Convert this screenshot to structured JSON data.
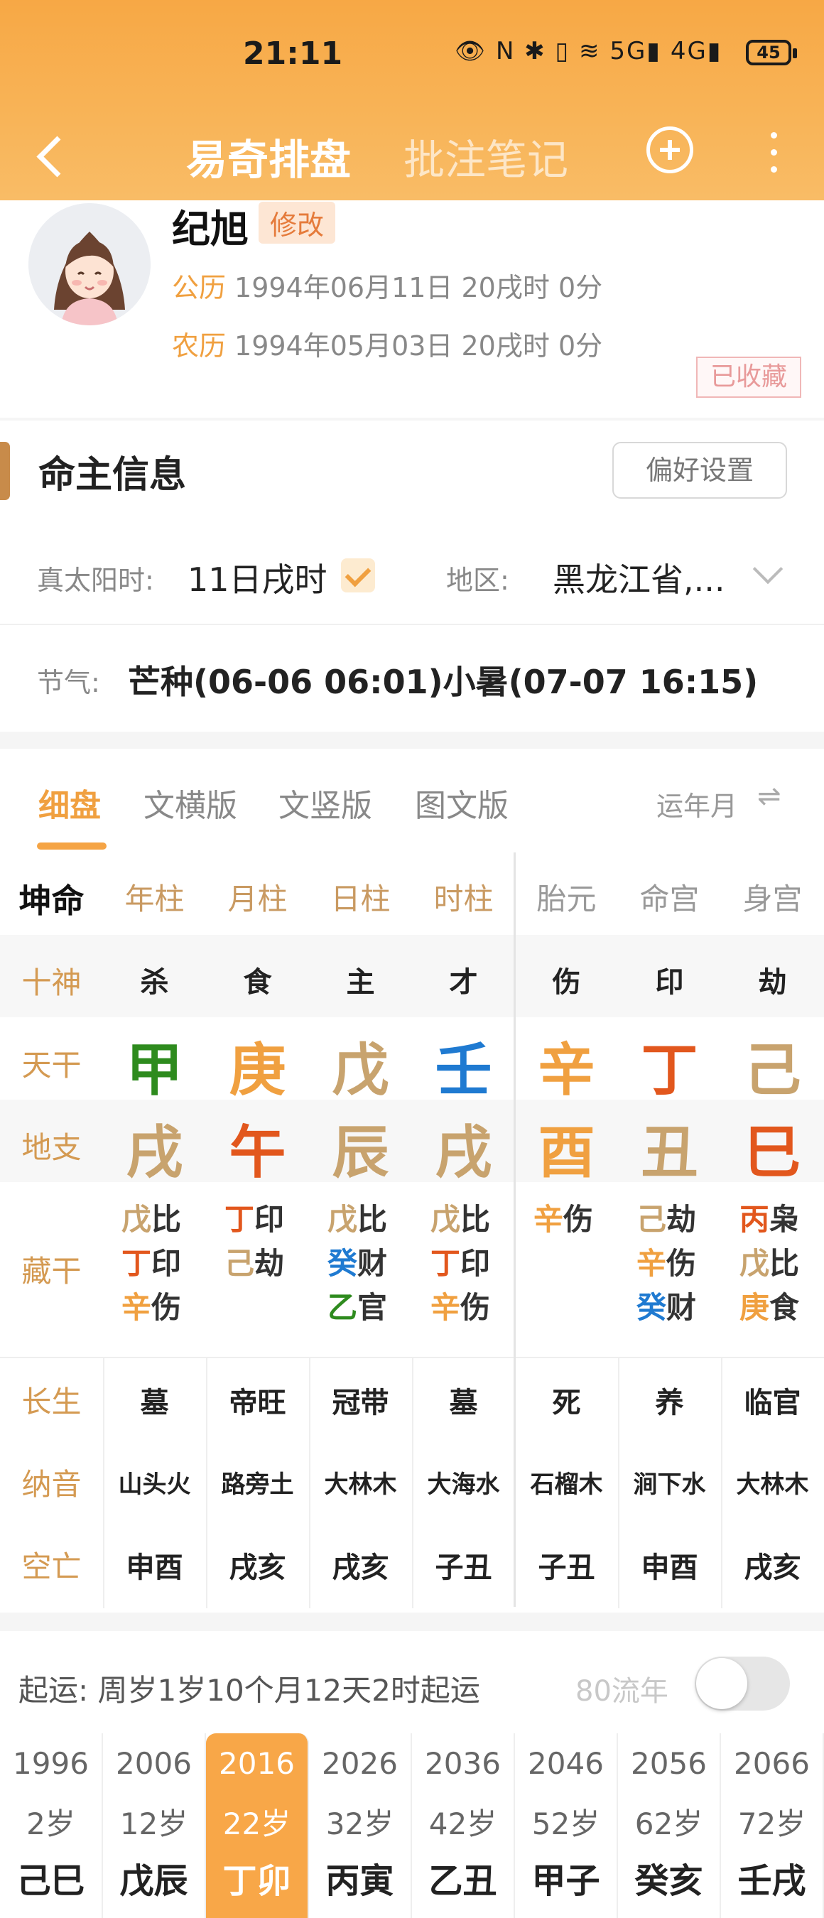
{
  "status": {
    "time": "21:11",
    "icons": "👁 N ✱ ▯ ≋ 5G▮ 4G▮",
    "battery": "45"
  },
  "nav": {
    "title": "易奇排盘",
    "notes_tab": "批注笔记"
  },
  "profile": {
    "name": "纪旭",
    "edit_label": "修改",
    "solar_label": "公历",
    "solar_value": "1994年06月11日 20戌时 0分",
    "lunar_label": "农历",
    "lunar_value": "1994年05月03日 20戌时 0分",
    "collected": "已收藏"
  },
  "owner_info": {
    "title": "命主信息",
    "pref_button": "偏好设置",
    "solar_time_label": "真太阳时:",
    "solar_time_value": "11日戌时",
    "region_label": "地区:",
    "region_value": "黑龙江省,...",
    "jieqi_label": "节气:",
    "jieqi_value": "芒种(06-06 06:01)小暑(07-07 16:15)"
  },
  "tabs": {
    "items": [
      "细盘",
      "文横版",
      "文竖版",
      "图文版"
    ],
    "active": 0,
    "yun_label": "运年月",
    "swap_icon": "⇌"
  },
  "grid": {
    "corner": "坤命",
    "columns": [
      "年柱",
      "月柱",
      "日柱",
      "时柱",
      "胎元",
      "命宫",
      "身宫"
    ],
    "shishen_label": "十神",
    "shishen": [
      "杀",
      "食",
      "主",
      "才",
      "伤",
      "印",
      "劫"
    ],
    "tiangan_label": "天干",
    "tiangan": [
      {
        "char": "甲",
        "color": "#2e8b1e"
      },
      {
        "char": "庚",
        "color": "#f0a040"
      },
      {
        "char": "戊",
        "color": "#c8a36e"
      },
      {
        "char": "壬",
        "color": "#1f7ad1"
      },
      {
        "char": "辛",
        "color": "#f0a040"
      },
      {
        "char": "丁",
        "color": "#e2571d"
      },
      {
        "char": "己",
        "color": "#c8a36e"
      }
    ],
    "dizhi_label": "地支",
    "dizhi": [
      {
        "char": "戌",
        "color": "#c8a36e"
      },
      {
        "char": "午",
        "color": "#e2571d"
      },
      {
        "char": "辰",
        "color": "#c8a36e"
      },
      {
        "char": "戌",
        "color": "#c8a36e"
      },
      {
        "char": "酉",
        "color": "#f0a040"
      },
      {
        "char": "丑",
        "color": "#c8a36e"
      },
      {
        "char": "巳",
        "color": "#e2571d"
      }
    ],
    "canggan_label": "藏干",
    "canggan": [
      [
        {
          "g": "戊",
          "s": "比",
          "c": "#c8a36e"
        },
        {
          "g": "丁",
          "s": "印",
          "c": "#e2571d"
        },
        {
          "g": "辛",
          "s": "伤",
          "c": "#f0a040"
        }
      ],
      [
        {
          "g": "丁",
          "s": "印",
          "c": "#e2571d"
        },
        {
          "g": "己",
          "s": "劫",
          "c": "#c8a36e"
        }
      ],
      [
        {
          "g": "戊",
          "s": "比",
          "c": "#c8a36e"
        },
        {
          "g": "癸",
          "s": "财",
          "c": "#1f7ad1"
        },
        {
          "g": "乙",
          "s": "官",
          "c": "#2e8b1e"
        }
      ],
      [
        {
          "g": "戊",
          "s": "比",
          "c": "#c8a36e"
        },
        {
          "g": "丁",
          "s": "印",
          "c": "#e2571d"
        },
        {
          "g": "辛",
          "s": "伤",
          "c": "#f0a040"
        }
      ],
      [
        {
          "g": "辛",
          "s": "伤",
          "c": "#f0a040"
        }
      ],
      [
        {
          "g": "己",
          "s": "劫",
          "c": "#c8a36e"
        },
        {
          "g": "辛",
          "s": "伤",
          "c": "#f0a040"
        },
        {
          "g": "癸",
          "s": "财",
          "c": "#1f7ad1"
        }
      ],
      [
        {
          "g": "丙",
          "s": "枭",
          "c": "#e2571d"
        },
        {
          "g": "戊",
          "s": "比",
          "c": "#c8a36e"
        },
        {
          "g": "庚",
          "s": "食",
          "c": "#f0a040"
        }
      ]
    ],
    "changsheng_label": "长生",
    "changsheng": [
      "墓",
      "帝旺",
      "冠带",
      "墓",
      "死",
      "养",
      "临官"
    ],
    "nayin_label": "纳音",
    "nayin": [
      "山头火",
      "路旁土",
      "大林木",
      "大海水",
      "石榴木",
      "涧下水",
      "大林木"
    ],
    "kongwang_label": "空亡",
    "kongwang": [
      "申酉",
      "戌亥",
      "戌亥",
      "子丑",
      "子丑",
      "申酉",
      "戌亥"
    ]
  },
  "qiyun": {
    "text": "起运:  周岁1岁10个月12天2时起运",
    "flow_label": "80流年",
    "flow_on": false
  },
  "dayun": [
    {
      "year": "1996",
      "age": "2岁",
      "gz": "己巳"
    },
    {
      "year": "2006",
      "age": "12岁",
      "gz": "戊辰"
    },
    {
      "year": "2016",
      "age": "22岁",
      "gz": "丁卯",
      "active": true
    },
    {
      "year": "2026",
      "age": "32岁",
      "gz": "丙寅"
    },
    {
      "year": "2036",
      "age": "42岁",
      "gz": "乙丑"
    },
    {
      "year": "2046",
      "age": "52岁",
      "gz": "甲子"
    },
    {
      "year": "2056",
      "age": "62岁",
      "gz": "癸亥"
    },
    {
      "year": "2066",
      "age": "72岁",
      "gz": "壬戌"
    }
  ]
}
